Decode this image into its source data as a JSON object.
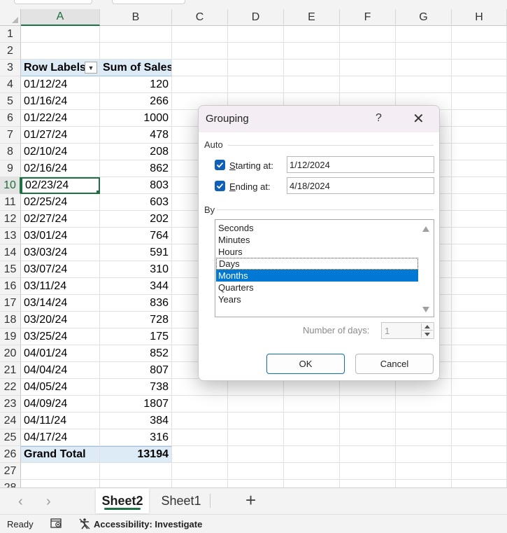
{
  "columns": [
    "A",
    "B",
    "C",
    "D",
    "E",
    "F",
    "G",
    "H"
  ],
  "active_column": "A",
  "active_row": "10",
  "pivot": {
    "header": {
      "row_labels": "Row Labels",
      "sum_label": "Sum of Sales"
    },
    "rows": [
      {
        "row": "4",
        "date": "01/12/24",
        "value": "120"
      },
      {
        "row": "5",
        "date": "01/16/24",
        "value": "266"
      },
      {
        "row": "6",
        "date": "01/22/24",
        "value": "1000"
      },
      {
        "row": "7",
        "date": "01/27/24",
        "value": "478"
      },
      {
        "row": "8",
        "date": "02/10/24",
        "value": "208"
      },
      {
        "row": "9",
        "date": "02/16/24",
        "value": "862"
      },
      {
        "row": "10",
        "date": "02/23/24",
        "value": "803"
      },
      {
        "row": "11",
        "date": "02/25/24",
        "value": "603"
      },
      {
        "row": "12",
        "date": "02/27/24",
        "value": "202"
      },
      {
        "row": "13",
        "date": "03/01/24",
        "value": "764"
      },
      {
        "row": "14",
        "date": "03/03/24",
        "value": "591"
      },
      {
        "row": "15",
        "date": "03/07/24",
        "value": "310"
      },
      {
        "row": "16",
        "date": "03/11/24",
        "value": "344"
      },
      {
        "row": "17",
        "date": "03/14/24",
        "value": "836"
      },
      {
        "row": "18",
        "date": "03/20/24",
        "value": "728"
      },
      {
        "row": "19",
        "date": "03/25/24",
        "value": "175"
      },
      {
        "row": "20",
        "date": "04/01/24",
        "value": "852"
      },
      {
        "row": "21",
        "date": "04/04/24",
        "value": "807"
      },
      {
        "row": "22",
        "date": "04/05/24",
        "value": "738"
      },
      {
        "row": "23",
        "date": "04/09/24",
        "value": "1807"
      },
      {
        "row": "24",
        "date": "04/11/24",
        "value": "384"
      },
      {
        "row": "25",
        "date": "04/17/24",
        "value": "316"
      }
    ],
    "total": {
      "label": "Grand Total",
      "value": "13194"
    }
  },
  "row_numbers": [
    "1",
    "2",
    "3",
    "4",
    "5",
    "6",
    "7",
    "8",
    "9",
    "10",
    "11",
    "12",
    "13",
    "14",
    "15",
    "16",
    "17",
    "18",
    "19",
    "20",
    "21",
    "22",
    "23",
    "24",
    "25",
    "26",
    "27",
    "28"
  ],
  "dialog": {
    "title": "Grouping",
    "help": "?",
    "close": "✕",
    "auto_label": "Auto",
    "starting_label": "Starting at:",
    "starting_value": "1/12/2024",
    "ending_label": "Ending at:",
    "ending_value": "4/18/2024",
    "by_label": "By",
    "options": [
      "Seconds",
      "Minutes",
      "Hours",
      "Days",
      "Months",
      "Quarters",
      "Years"
    ],
    "focused_option": "Days",
    "selected_option": "Months",
    "number_of_days_label": "Number of days:",
    "number_of_days_value": "1",
    "ok_label": "OK",
    "cancel_label": "Cancel"
  },
  "sheets": {
    "active": "Sheet2",
    "other": "Sheet1",
    "add": "+",
    "prev": "‹",
    "next": "›"
  },
  "status": {
    "ready": "Ready",
    "accessibility": "Accessibility: Investigate"
  },
  "colors": {
    "accent_green": "#1e7145",
    "pivot_fill": "#ddebf7",
    "selection_blue": "#0078d4",
    "checkbox_blue": "#1160b8"
  }
}
